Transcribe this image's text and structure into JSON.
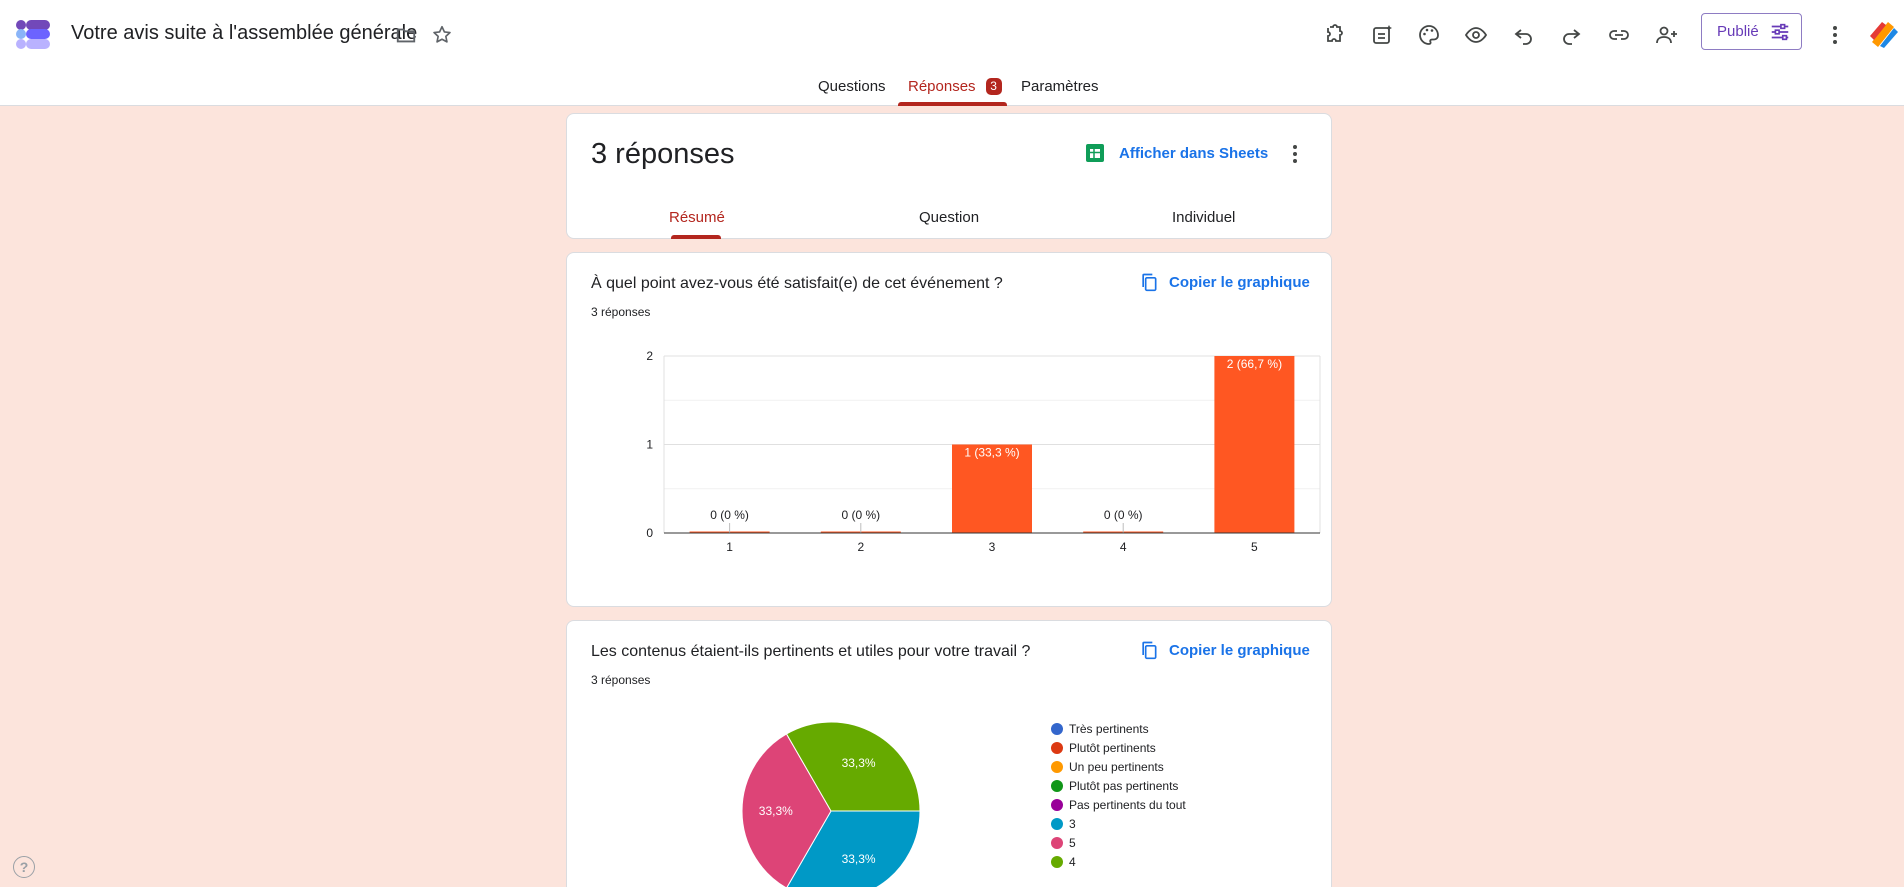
{
  "app": {
    "title": "Votre avis suite à l'assemblée générale",
    "publish_label": "Publié"
  },
  "main_tabs": {
    "questions": "Questions",
    "responses": "Réponses",
    "responses_badge": "3",
    "settings": "Paramètres"
  },
  "summary": {
    "count_label": "3 réponses",
    "sheets_label": "Afficher dans Sheets",
    "tabs": {
      "summary": "Résumé",
      "question": "Question",
      "individual": "Individuel"
    }
  },
  "questions": [
    {
      "title": "À quel point avez-vous été satisfait(e) de cet événement ?",
      "count_label": "3 réponses",
      "copy_label": "Copier le graphique"
    },
    {
      "title": "Les contenus étaient-ils pertinents et utiles pour votre travail ?",
      "count_label": "3 réponses",
      "copy_label": "Copier le graphique"
    }
  ],
  "chart_data": [
    {
      "type": "bar",
      "categories": [
        "1",
        "2",
        "3",
        "4",
        "5"
      ],
      "values": [
        0,
        0,
        1,
        0,
        2
      ],
      "data_labels": [
        "0 (0 %)",
        "0 (0 %)",
        "1 (33,3 %)",
        "0 (0 %)",
        "2 (66,7 %)"
      ],
      "ylim": [
        0,
        2
      ],
      "yticks": [
        "0",
        "1",
        "2"
      ],
      "color": "#ff5722",
      "grid": true
    },
    {
      "type": "pie",
      "slices": [
        {
          "label": "3",
          "value": 33.3,
          "display": "33,3%",
          "color": "#0099c6"
        },
        {
          "label": "5",
          "value": 33.3,
          "display": "33,3%",
          "color": "#dd4477"
        },
        {
          "label": "4",
          "value": 33.3,
          "display": "33,3%",
          "color": "#66aa00"
        }
      ],
      "legend": [
        {
          "label": "Très pertinents",
          "color": "#3366cc"
        },
        {
          "label": "Plutôt pertinents",
          "color": "#dc3912"
        },
        {
          "label": "Un peu pertinents",
          "color": "#ff9900"
        },
        {
          "label": "Plutôt pas pertinents",
          "color": "#109618"
        },
        {
          "label": "Pas pertinents du tout",
          "color": "#990099"
        },
        {
          "label": "3",
          "color": "#0099c6"
        },
        {
          "label": "5",
          "color": "#dd4477"
        },
        {
          "label": "4",
          "color": "#66aa00"
        }
      ],
      "legend_position": "right"
    }
  ]
}
